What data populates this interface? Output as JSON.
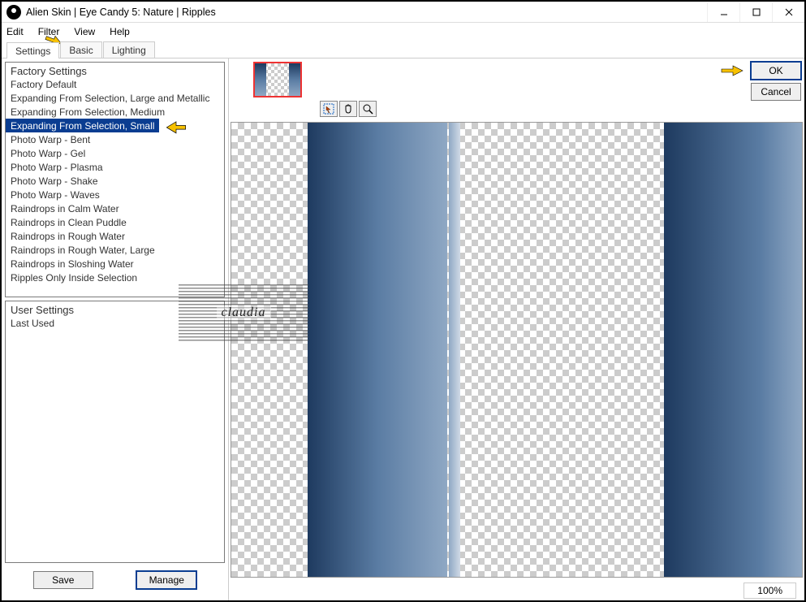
{
  "window": {
    "title": "Alien Skin | Eye Candy 5: Nature | Ripples"
  },
  "menu": {
    "edit": "Edit",
    "filter": "Filter",
    "view": "View",
    "help": "Help"
  },
  "tabs": {
    "settings": "Settings",
    "basic": "Basic",
    "lighting": "Lighting"
  },
  "factory": {
    "header": "Factory Settings",
    "items": [
      "Factory Default",
      "Expanding From Selection, Large and Metallic",
      "Expanding From Selection, Medium",
      "Expanding From Selection, Small",
      "Photo Warp - Bent",
      "Photo Warp - Gel",
      "Photo Warp - Plasma",
      "Photo Warp - Shake",
      "Photo Warp - Waves",
      "Raindrops in Calm Water",
      "Raindrops in Clean Puddle",
      "Raindrops in Rough Water",
      "Raindrops in Rough Water, Large",
      "Raindrops in Sloshing Water",
      "Ripples Only Inside Selection"
    ],
    "selected_index": 3
  },
  "user": {
    "header": "User Settings",
    "items": [
      "Last Used"
    ]
  },
  "buttons": {
    "save": "Save",
    "manage": "Manage",
    "ok": "OK",
    "cancel": "Cancel"
  },
  "toolstrip": {
    "marquee": "marquee-tool",
    "hand": "hand-tool",
    "zoom": "zoom-tool"
  },
  "status": {
    "zoom": "100%"
  },
  "watermark": {
    "text": "claudia"
  }
}
